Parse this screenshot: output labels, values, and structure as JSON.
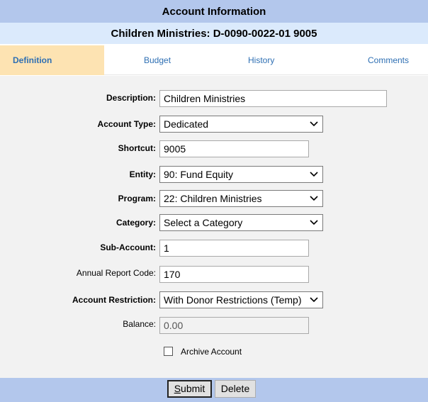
{
  "header": {
    "title": "Account Information",
    "subtitle": "Children Ministries: D-0090-0022-01 9005"
  },
  "tabs": [
    {
      "label": "Definition",
      "active": true
    },
    {
      "label": "Budget",
      "active": false
    },
    {
      "label": "History",
      "active": false
    },
    {
      "label": "Comments",
      "active": false
    }
  ],
  "form": {
    "description": {
      "label": "Description:",
      "value": "Children Ministries"
    },
    "account_type": {
      "label": "Account Type:",
      "value": "Dedicated"
    },
    "shortcut": {
      "label": "Shortcut:",
      "value": "9005"
    },
    "entity": {
      "label": "Entity:",
      "value": "90: Fund Equity"
    },
    "program": {
      "label": "Program:",
      "value": "22: Children Ministries"
    },
    "category": {
      "label": "Category:",
      "value": "Select a Category"
    },
    "sub_account": {
      "label": "Sub-Account:",
      "value": "1"
    },
    "annual_report_code": {
      "label": "Annual Report Code:",
      "value": "170"
    },
    "account_restriction": {
      "label": "Account Restriction:",
      "value": "With Donor Restrictions (Temp)"
    },
    "balance": {
      "label": "Balance:",
      "value": "0.00"
    },
    "archive": {
      "label": "Archive Account",
      "checked": false
    }
  },
  "footer": {
    "submit_first": "S",
    "submit_rest": "ubmit",
    "delete_label": "Delete"
  },
  "icons": {
    "dropdown": "chevron-down-icon",
    "checkbox": "checkbox-icon"
  },
  "colors": {
    "title_bg": "#b3c7ec",
    "subtitle_bg": "#dbeafc",
    "active_tab": "#fde3b2",
    "tab_text": "#2e6fb3",
    "form_bg": "#f2f2f2"
  }
}
